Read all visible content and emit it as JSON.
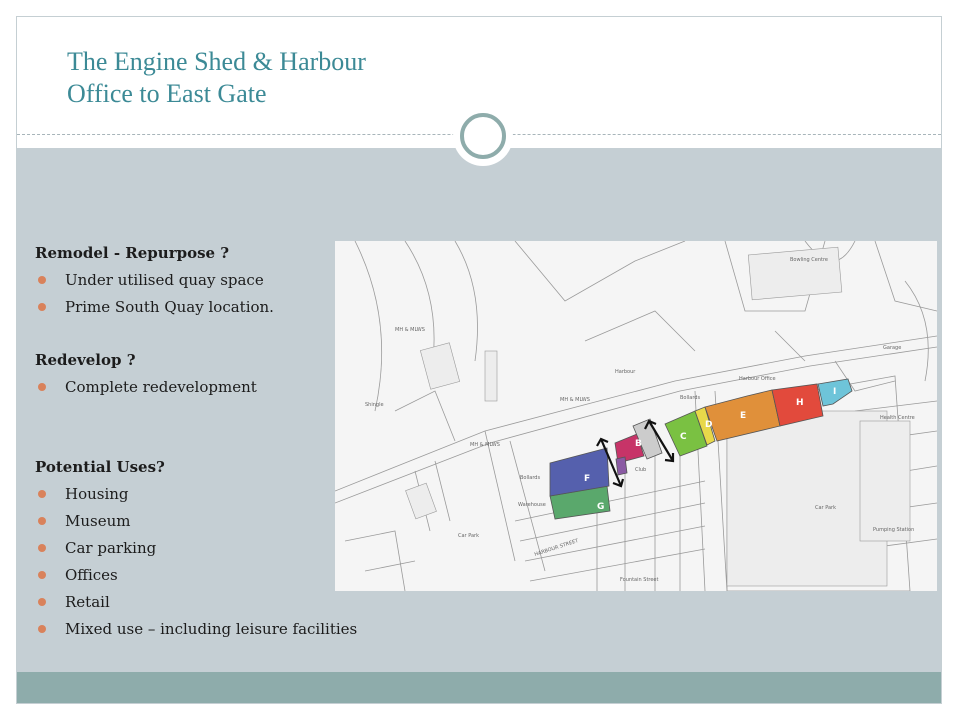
{
  "title": {
    "line1": "The Engine Shed & Harbour",
    "line2": "Office to East Gate"
  },
  "colors": {
    "title": "#3c8a96",
    "band": "#c5cfd4",
    "footer": "#8eacab",
    "bullet": "#d9825b"
  },
  "sections": {
    "remodel": {
      "heading": "Remodel -  Repurpose ?",
      "items": [
        "Under utilised quay space",
        "Prime South Quay location."
      ]
    },
    "redevelop": {
      "heading": "Redevelop ?",
      "items": [
        "Complete redevelopment"
      ]
    },
    "uses": {
      "heading": "Potential Uses?",
      "items": [
        "Housing",
        "Museum",
        "Car parking",
        "Offices",
        "Retail",
        "Mixed use – including leisure facilities"
      ]
    }
  },
  "map": {
    "plots": {
      "b": "B",
      "c": "C",
      "d": "D",
      "e": "E",
      "f": "F",
      "g": "G",
      "h": "H",
      "i": "I"
    },
    "labels": {
      "harbour": "Harbour",
      "harbour_office": "Harbour Office",
      "car_park": "Car Park",
      "car_park_small": "Car Park",
      "warehouse": "Warehouse",
      "harbour_street": "HARBOUR STREET",
      "health_centre": "Health Centre",
      "bowling_centre": "Bowling Centre",
      "club": "Club",
      "mhw_1": "MH & MLWS",
      "mhw_2": "MH & MLWS",
      "mhw_3": "MH & MLWS",
      "bollards_1": "Bollards",
      "bollards_2": "Bollards",
      "shingle": "Shingle",
      "fountain_street": "Fountain Street",
      "pumping_station": "Pumping Station",
      "garage": "Garage"
    }
  }
}
